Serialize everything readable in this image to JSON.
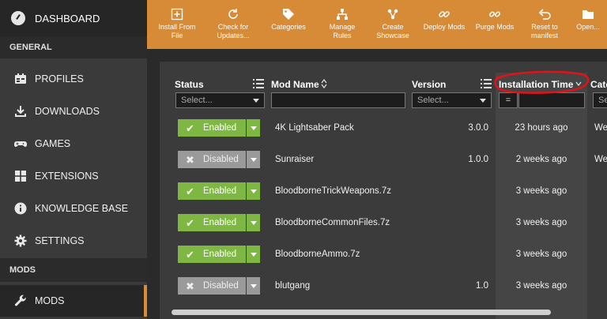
{
  "sidebar": {
    "dashboard": "DASHBOARD",
    "general_header": "GENERAL",
    "items": [
      {
        "label": "PROFILES",
        "icon": "profiles-icon"
      },
      {
        "label": "DOWNLOADS",
        "icon": "download-icon"
      },
      {
        "label": "GAMES",
        "icon": "gamepad-icon"
      },
      {
        "label": "EXTENSIONS",
        "icon": "extensions-icon"
      },
      {
        "label": "KNOWLEDGE BASE",
        "icon": "info-icon"
      },
      {
        "label": "SETTINGS",
        "icon": "gear-icon"
      }
    ],
    "mods_header": "MODS",
    "mods_item": "MODS"
  },
  "toolbar": {
    "install_from_file": "Install From\nFile",
    "check_updates": "Check for\nUpdates...",
    "categories": "Categories",
    "manage_rules": "Manage\nRules",
    "create_showcase": "Create\nShowcase",
    "deploy_mods": "Deploy Mods",
    "purge_mods": "Purge Mods",
    "reset_manifest": "Reset to\nmanifest",
    "open": "Open..."
  },
  "table": {
    "headers": {
      "status": "Status",
      "mod_name": "Mod Name",
      "version": "Version",
      "install_time": "Installation Time",
      "category": "Cate"
    },
    "filters": {
      "status": "Select...",
      "version": "Select...",
      "install_op": "=",
      "category": "Se"
    },
    "rows": [
      {
        "status": "Enabled",
        "name": "4K Lightsaber Pack",
        "version": "3.0.0",
        "time": "23 hours ago",
        "cat": "We"
      },
      {
        "status": "Disabled",
        "name": "Sunraiser",
        "version": "1.0.0",
        "time": "2 weeks ago",
        "cat": "We"
      },
      {
        "status": "Enabled",
        "name": "BloodborneTrickWeapons.7z",
        "version": "",
        "time": "3 weeks ago",
        "cat": ""
      },
      {
        "status": "Enabled",
        "name": "BloodborneCommonFiles.7z",
        "version": "",
        "time": "3 weeks ago",
        "cat": ""
      },
      {
        "status": "Enabled",
        "name": "BloodborneAmmo.7z",
        "version": "",
        "time": "3 weeks ago",
        "cat": ""
      },
      {
        "status": "Disabled",
        "name": "blutgang",
        "version": "1.0",
        "time": "3 weeks ago",
        "cat": ""
      }
    ]
  },
  "colors": {
    "accent": "#d88b37",
    "enabled": "#7eb843",
    "disabled": "#9a9a9a",
    "annotation": "#e0121a"
  }
}
